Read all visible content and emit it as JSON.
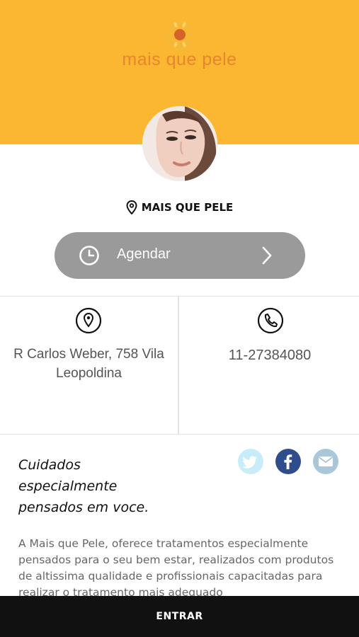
{
  "header": {
    "brand_text": "mais que pele",
    "background_color": "#fbb731",
    "logo_icon": "sun-flower-icon"
  },
  "profile": {
    "avatar": "woman-face-avatar",
    "business_name": "MAIS QUE PELE",
    "name_icon": "location-pin-icon"
  },
  "schedule_button": {
    "label": "Agendar",
    "icon": "clock-icon",
    "arrow_icon": "chevron-right-icon"
  },
  "info": {
    "address": "R Carlos Weber, 758 Vila Leopoldina",
    "address_icon": "location-pin-icon",
    "phone": "11-27384080",
    "phone_icon": "phone-icon"
  },
  "about": {
    "tagline": "Cuidados especialmente pensados em voce.",
    "description": "A Mais que Pele, oferece tratamentos especialmente pensados para o seu bem estar, realizados com produtos de altissima qualidade e profissionais capacitadas para realizar o tratamento mais adequado"
  },
  "social": {
    "twitter_icon": "twitter-icon",
    "facebook_icon": "facebook-icon",
    "mail_icon": "mail-icon"
  },
  "footer": {
    "enter_label": "ENTRAR"
  }
}
